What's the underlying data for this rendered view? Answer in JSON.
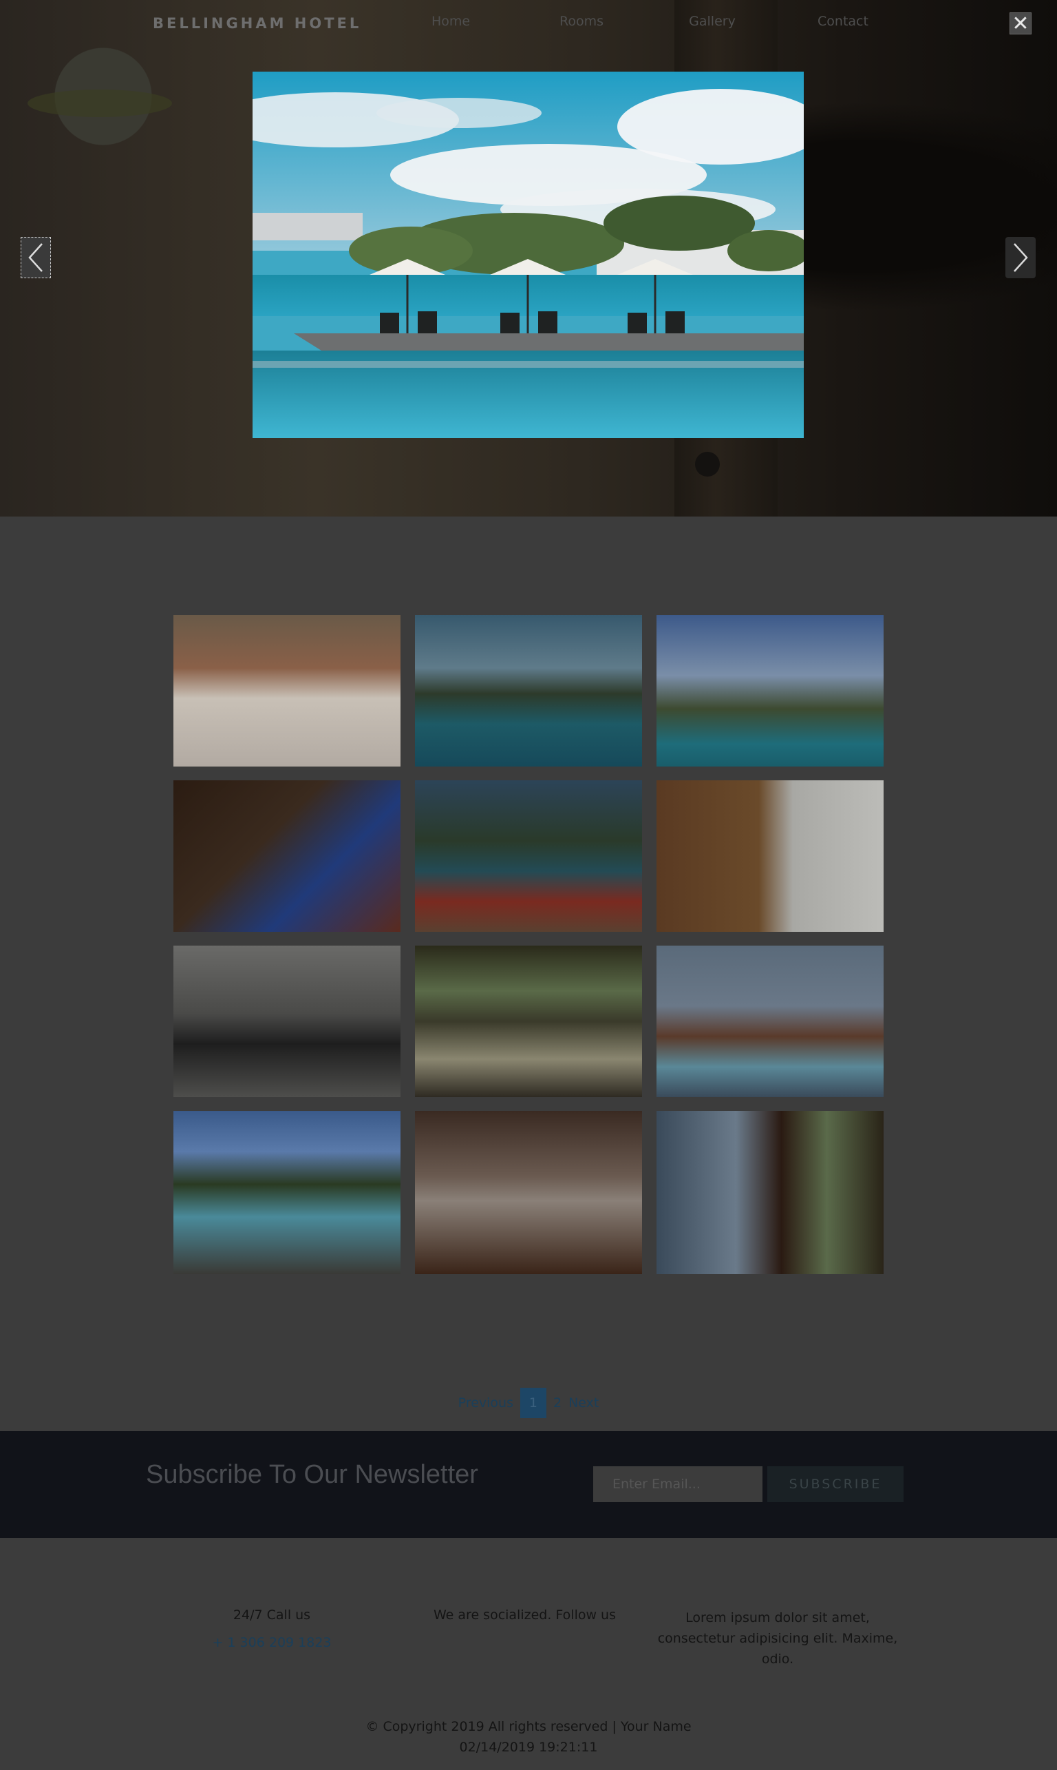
{
  "nav": {
    "brand": "BELLINGHAM HOTEL",
    "links": [
      "Home",
      "Rooms",
      "Gallery",
      "Contact"
    ]
  },
  "lightbox": {
    "close_glyph": "✕",
    "prev_icon": "chevron-left-icon",
    "next_icon": "chevron-right-icon"
  },
  "gallery": {
    "count": 12
  },
  "pagination": {
    "previous": "Previous",
    "pages": [
      "1",
      "2"
    ],
    "current": "1",
    "next": "Next"
  },
  "newsletter": {
    "title": "Subscribe To Our Newsletter",
    "email_placeholder": "Enter Email...",
    "button_label": "SUBSCRIBE"
  },
  "footer": {
    "call_label": "24/7 Call us",
    "phone": "+ 1 306 209 1823",
    "social_label": "We are socialized. Follow us",
    "about_text": "Lorem ipsum dolor sit amet, consectetur adipisicing elit. Maxime, odio.",
    "copyright": "© Copyright 2019 All rights reserved | Your Name",
    "timestamp": "02/14/2019 19:21:11"
  },
  "colors": {
    "overlay_dim": "#3c3c3c",
    "newsletter_bg": "#111319",
    "link": "#1a3f5a",
    "active_page": "#1d4666"
  }
}
